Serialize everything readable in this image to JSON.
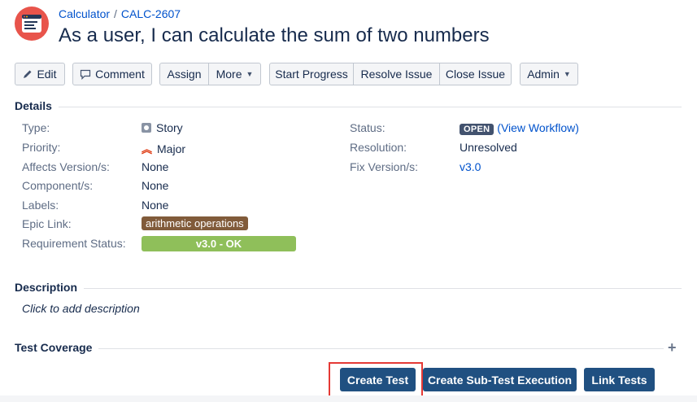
{
  "breadcrumb": {
    "project": "Calculator",
    "separator": "/",
    "issue_key": "CALC-2607"
  },
  "issue": {
    "summary": "As a user, I can calculate the sum of two numbers"
  },
  "toolbar": {
    "edit": "Edit",
    "comment": "Comment",
    "assign": "Assign",
    "more": "More",
    "start_progress": "Start Progress",
    "resolve_issue": "Resolve Issue",
    "close_issue": "Close Issue",
    "admin": "Admin"
  },
  "details": {
    "title": "Details",
    "type_label": "Type:",
    "type_value": "Story",
    "priority_label": "Priority:",
    "priority_value": "Major",
    "affects_label": "Affects Version/s:",
    "affects_value": "None",
    "component_label": "Component/s:",
    "component_value": "None",
    "labels_label": "Labels:",
    "labels_value": "None",
    "epic_label": "Epic Link:",
    "epic_value": "arithmetic operations",
    "req_label": "Requirement Status:",
    "req_value": "v3.0 - OK",
    "status_label": "Status:",
    "status_value": "OPEN",
    "workflow_link": "View Workflow",
    "resolution_label": "Resolution:",
    "resolution_value": "Unresolved",
    "fix_label": "Fix Version/s:",
    "fix_value": "v3.0"
  },
  "description": {
    "title": "Description",
    "placeholder": "Click to add description"
  },
  "test_coverage": {
    "title": "Test Coverage",
    "create_test": "Create Test",
    "create_sub_test": "Create Sub-Test Execution",
    "link_tests": "Link Tests"
  },
  "colors": {
    "primary_button": "#205081",
    "epic": "#815b3a",
    "requirement_ok": "#8fbf5a",
    "highlight": "#e53935",
    "link": "#0052cc"
  }
}
